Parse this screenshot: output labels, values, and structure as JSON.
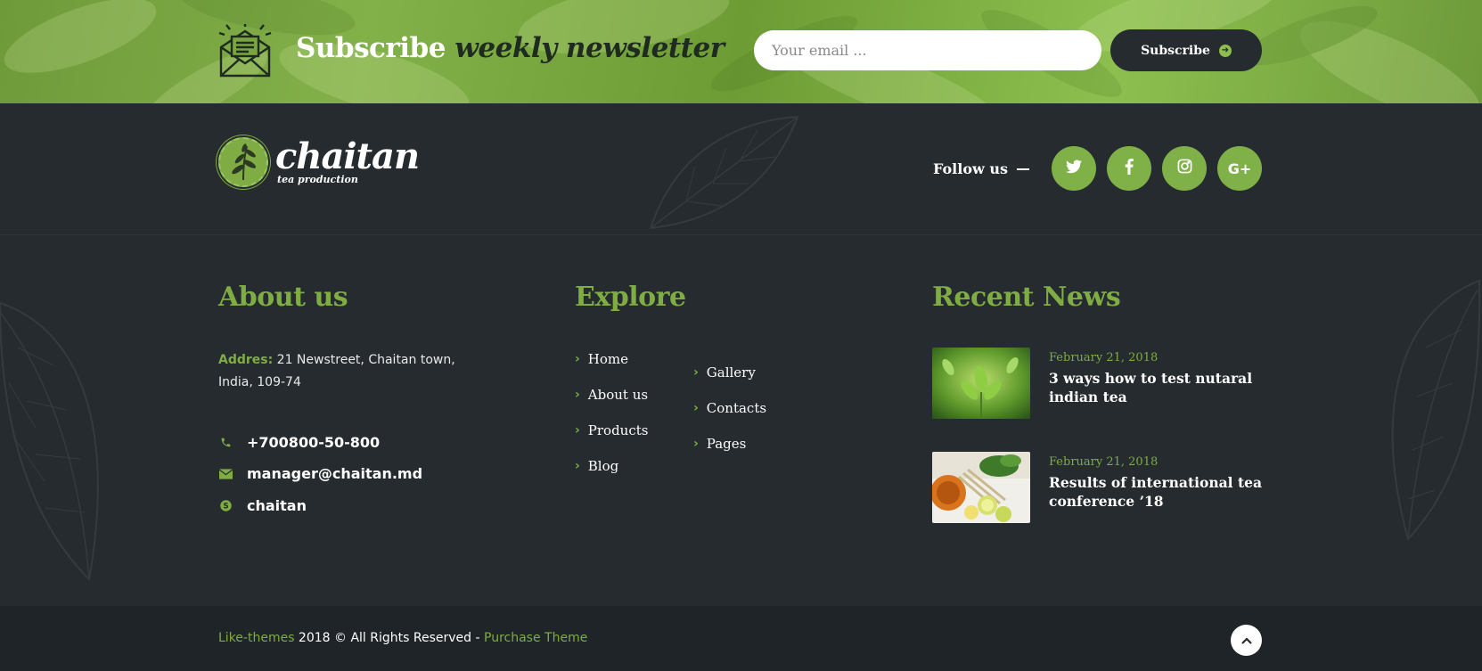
{
  "newsletter": {
    "title_main": "Subscribe",
    "title_em": "weekly newsletter",
    "email_placeholder": "Your email ...",
    "subscribe_label": "Subscribe",
    "icon": "newsletter-envelope-icon"
  },
  "brand": {
    "logo_name": "chaitan",
    "logo_tagline": "tea production",
    "follow_label": "Follow us",
    "social": [
      {
        "name": "twitter-icon",
        "glyph": "t"
      },
      {
        "name": "facebook-icon",
        "glyph": "f"
      },
      {
        "name": "instagram-icon",
        "glyph": "◎"
      },
      {
        "name": "google-plus-icon",
        "glyph": "G+"
      }
    ]
  },
  "about": {
    "title": "About us",
    "address_label": "Addres:",
    "address_value": "21 Newstreet, Chaitan town, India, 109-74",
    "phone": "+700800-50-800",
    "email": "manager@chaitan.md",
    "skype": "chaitan"
  },
  "explore": {
    "title": "Explore",
    "col1": [
      "Home",
      "About us",
      "Products",
      "Blog"
    ],
    "col2": [
      "Gallery",
      "Contacts",
      "Pages"
    ]
  },
  "news": {
    "title": "Recent News",
    "items": [
      {
        "date": "February 21, 2018",
        "title": "3 ways how to test nutaral indian tea"
      },
      {
        "date": "February 21, 2018",
        "title": "Results of international tea conference ’18"
      }
    ]
  },
  "footer": {
    "brand_link": "Like-themes",
    "copyright": " 2018 © All Rights Reserved - ",
    "purchase_link": "Purchase Theme"
  },
  "colors": {
    "accent": "#7fad44",
    "dark": "#252b2e",
    "bottom": "#1e2427"
  }
}
